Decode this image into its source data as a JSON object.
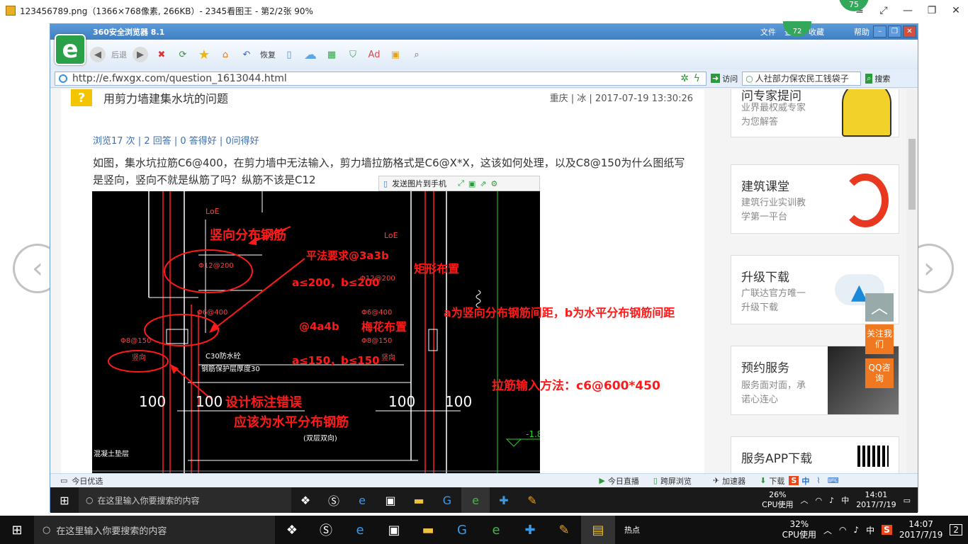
{
  "viewer": {
    "title": "123456789.png（1366×768像素, 266KB）- 2345看图王 - 第2/2张 90%",
    "badge": "75",
    "prev_glyph": "‹",
    "next_glyph": "›"
  },
  "browser": {
    "title": "360安全浏览器 8.1",
    "menu": [
      "文件",
      "查看",
      "收藏",
      "帮助"
    ],
    "badge": "72",
    "toolbar": {
      "back": "后退",
      "restore": "恢复"
    },
    "url": "http://e.fwxgx.com/question_1613044.html",
    "visit": "访问",
    "search_value": "人社部力保农民工钱袋子",
    "search_btn": "搜索"
  },
  "question": {
    "title": "用剪力墙建集水坑的问题",
    "meta": "重庆 | 冰 | 2017-07-19 13:30:26",
    "stats": "浏览17 次 | 2 回答 | 0 答得好 | 0问得好",
    "body": "如图，集水坑拉筋C6@400，在剪力墙中无法输入，剪力墙拉筋格式是C6@X*X，这该如何处理，以及C8@150为什么图纸写是竖向，竖向不就是纵筋了吗？纵筋不该是C12"
  },
  "image_toolbar": {
    "send": "发送图片到手机"
  },
  "cad": {
    "label_loe1": "LoE",
    "label_loe2": "LoE",
    "phi12": "Φ12@200",
    "phi12b": "Φ12@200",
    "phi6a": "Φ6@400",
    "phi6b": "Φ6@400",
    "phi8a": "Φ8@150",
    "phi8b": "Φ8@150",
    "vert1": "竖向",
    "vert2": "竖向",
    "c30": "C30防水砼",
    "cover": "钢筋保护层厚度30",
    "n100a": "100",
    "n100b": "100",
    "n100c": "100",
    "n100d": "100",
    "bottom_left": "混凝土垫层",
    "bottom_mid": "(双层双向)",
    "side_num": "-1.8"
  },
  "annotations": {
    "a1": "竖向分布钢筋",
    "a2": "平法要求@3a3b",
    "a3": "矩形布置",
    "a4": "a≤200，b≤200",
    "a5": "a为竖向分布钢筋间距，b为水平分布钢筋间距",
    "a6": "@4a4b",
    "a7": "梅花布置",
    "a8": "a≤150，b≤150",
    "a9": "拉筋输入方法：c6@600*450",
    "a10": "设计标注错误",
    "a11": "应该为水平分布钢筋"
  },
  "sidebar": {
    "card0_title": "问专家提问",
    "card0_desc1": "业界最权威专家",
    "card0_desc2": "为您解答",
    "card1_title": "建筑课堂",
    "card1_desc1": "建筑行业实训教",
    "card1_desc2": "学第一平台",
    "card2_title": "升级下载",
    "card2_desc1": "广联达官方唯一",
    "card2_desc2": "升级下载",
    "card3_title": "预约服务",
    "card3_desc1": "服务面对面，承",
    "card3_desc2": "诺心连心",
    "card4_title": "服务APP下载"
  },
  "float": {
    "follow": "关注我们",
    "qq": "QQ咨询"
  },
  "status": {
    "left": "今日优选",
    "live": "今日直播",
    "cross": "跨屏浏览",
    "accel": "加速器",
    "down": "下载"
  },
  "inner_taskbar": {
    "search": "在这里输入你要搜索的内容",
    "cpu_pct": "26%",
    "cpu_label": "CPU使用",
    "ime": "中",
    "time": "14:01",
    "date": "2017/7/19"
  },
  "taskbar": {
    "search": "在这里输入你要搜索的内容",
    "cpu_pct": "32%",
    "cpu_label": "CPU使用",
    "ime": "中",
    "time": "14:07",
    "date": "2017/7/19",
    "notif": "2",
    "hot": "热点"
  }
}
